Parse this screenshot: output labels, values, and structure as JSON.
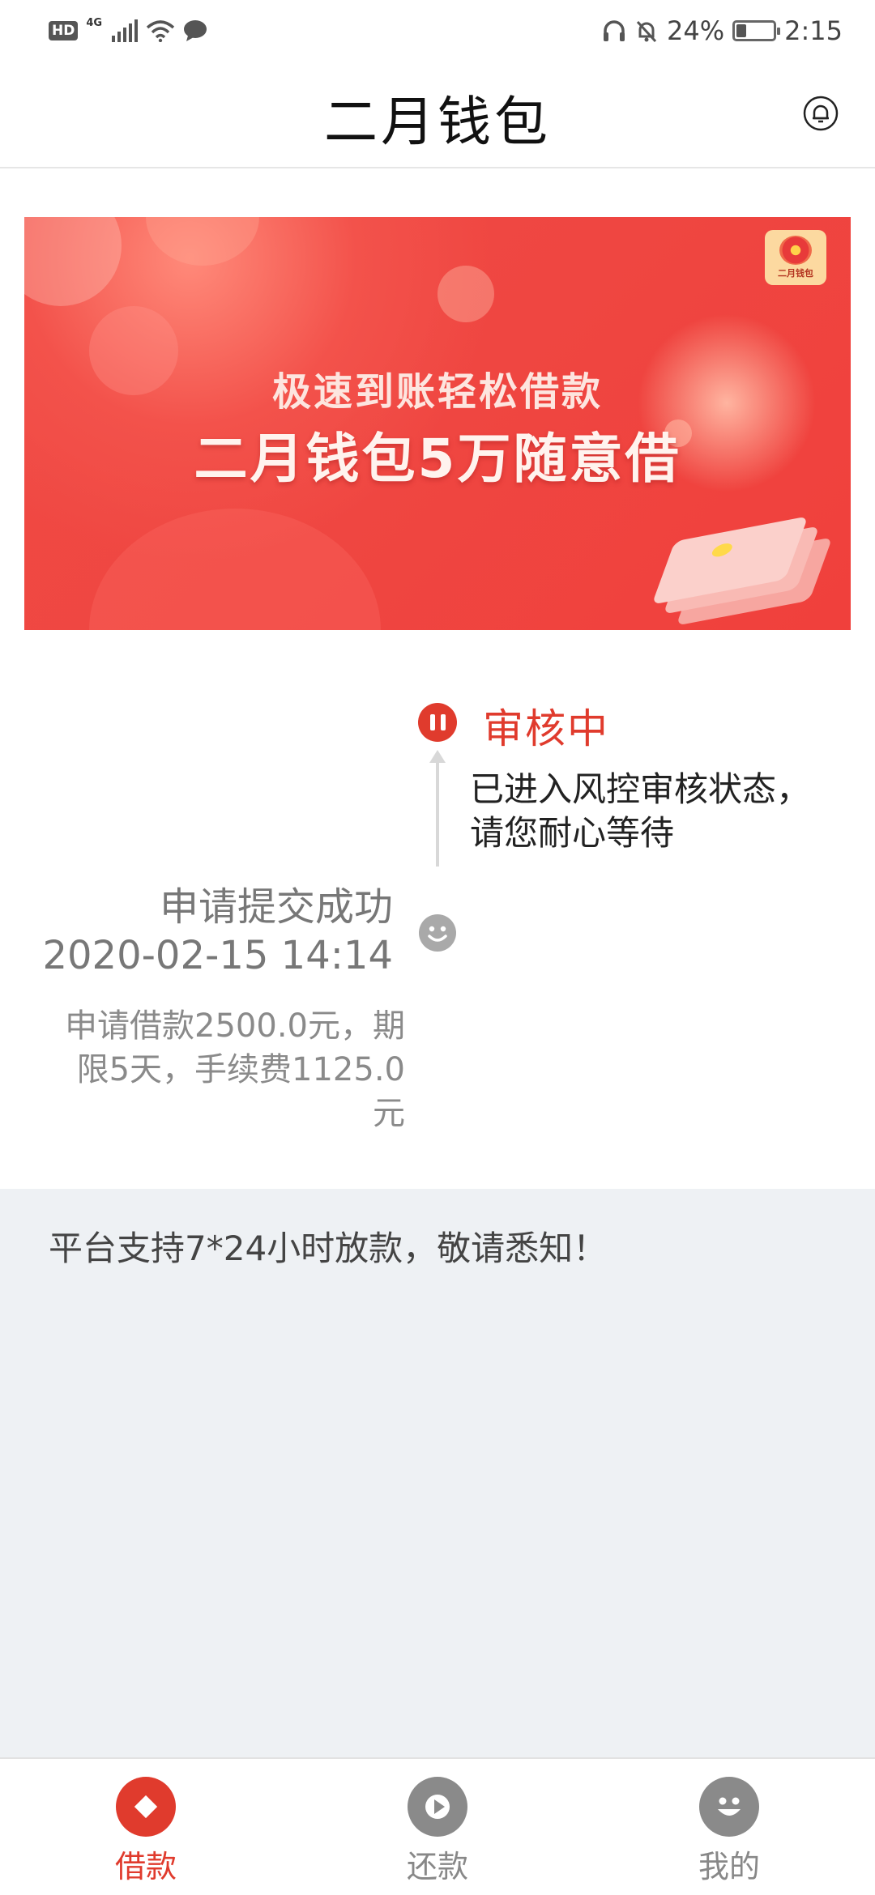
{
  "status_bar": {
    "hd_badge": "HD",
    "network": "4G",
    "battery_percent": "24%",
    "battery_level": 0.24,
    "time": "2:15"
  },
  "header": {
    "title": "二月钱包",
    "bell_icon": "bell-icon"
  },
  "banner": {
    "logo_text": "二月钱包",
    "line1": "极速到账轻松借款",
    "line2": "二月钱包5万随意借"
  },
  "timeline": {
    "current_status": "审核中",
    "current_desc_line1": "已进入风控审核状态，",
    "current_desc_line2": "请您耐心等待",
    "submit_title": "申请提交成功",
    "submit_time": "2020-02-15 14:14",
    "detail_line1": "申请借款2500.0元，期",
    "detail_line2": "限5天，手续费1125.0",
    "detail_line3": "元"
  },
  "notice": {
    "text": "平台支持7*24小时放款，敬请悉知！"
  },
  "tab_bar": {
    "tabs": [
      {
        "label": "借款",
        "icon": "diamond-icon",
        "active": true
      },
      {
        "label": "还款",
        "icon": "play-icon",
        "active": false
      },
      {
        "label": "我的",
        "icon": "smiley-icon",
        "active": false
      }
    ]
  },
  "colors": {
    "accent": "#e03b2d",
    "banner_red": "#f04a44",
    "notice_bg": "#eef1f4",
    "inactive_icon": "#8a8a8a"
  }
}
